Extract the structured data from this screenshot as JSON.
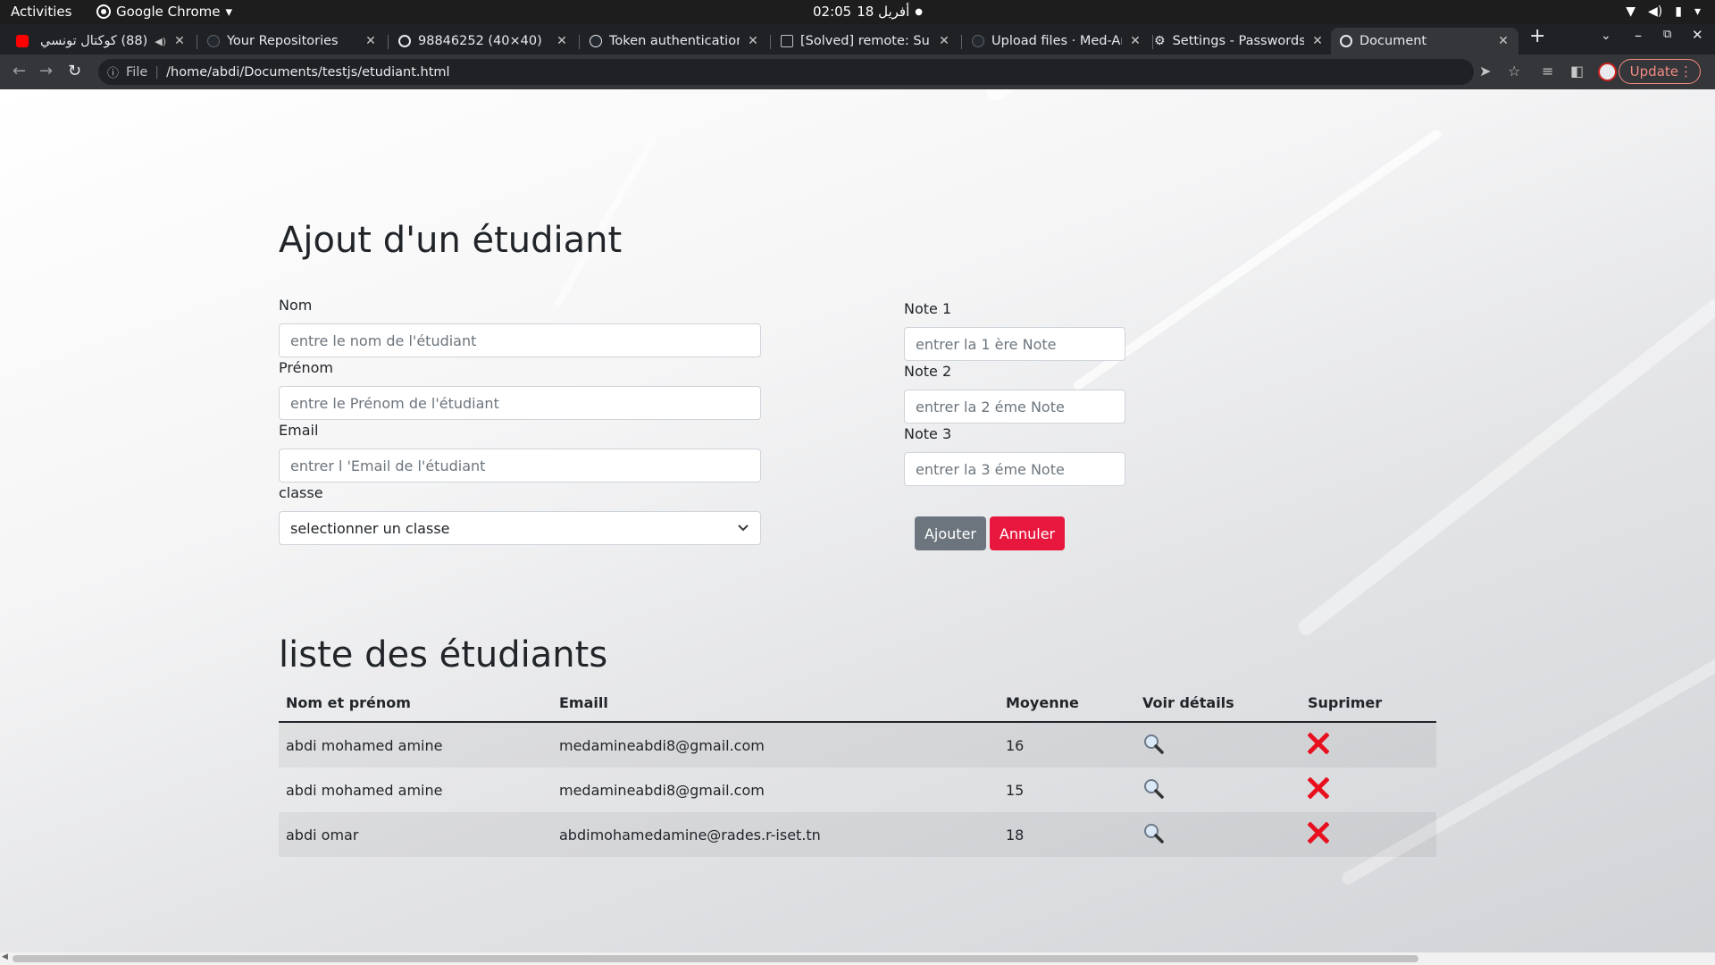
{
  "system": {
    "activities": "Activities",
    "app_name": "Google Chrome",
    "clock_time": "02:05",
    "clock_date": "أفريل 18"
  },
  "tabs": [
    {
      "title": "(88) كوكتال تونسي",
      "fav_color": "#ff0000"
    },
    {
      "title": "Your Repositories",
      "fav_color": "#24292f"
    },
    {
      "title": "98846252 (40×40)",
      "fav_color": "#e8eaed"
    },
    {
      "title": "Token authentication",
      "fav_color": "#24292f"
    },
    {
      "title": "[Solved] remote: Supp",
      "fav_color": "#5f6368"
    },
    {
      "title": "Upload files · Med-Am",
      "fav_color": "#24292f"
    },
    {
      "title": "Settings - Passwords",
      "fav_color": "#e8eaed"
    },
    {
      "title": "Document",
      "fav_color": "#e8eaed"
    }
  ],
  "address": {
    "scheme_label": "File",
    "url": "/home/abdi/Documents/testjs/etudiant.html",
    "update_label": "Update"
  },
  "form": {
    "title": "Ajout d'un étudiant",
    "nom_label": "Nom",
    "nom_placeholder": "entre le nom de l'étudiant",
    "prenom_label": "Prénom",
    "prenom_placeholder": "entre le Prénom de l'étudiant",
    "email_label": "Email",
    "email_placeholder": "entrer l 'Email de l'étudiant",
    "classe_label": "classe",
    "classe_selected": "selectionner un classe",
    "note1_label": "Note 1",
    "note1_placeholder": "entrer la 1 ère Note",
    "note2_label": "Note 2",
    "note2_placeholder": "entrer la 2 éme Note",
    "note3_label": "Note 3",
    "note3_placeholder": "entrer la 3 éme Note",
    "ajouter_label": "Ajouter",
    "annuler_label": "Annuler"
  },
  "list": {
    "title": "liste des étudiants",
    "headers": [
      "Nom et prénom",
      "Emaill",
      "Moyenne",
      "Voir détails",
      "Suprimer"
    ],
    "rows": [
      {
        "name": "abdi mohamed amine",
        "email": "medamineabdi8@gmail.com",
        "moyenne": "16"
      },
      {
        "name": "abdi mohamed amine",
        "email": "medamineabdi8@gmail.com",
        "moyenne": "15"
      },
      {
        "name": "abdi omar",
        "email": "abdimohamedamine@rades.r-iset.tn",
        "moyenne": "18"
      }
    ]
  }
}
